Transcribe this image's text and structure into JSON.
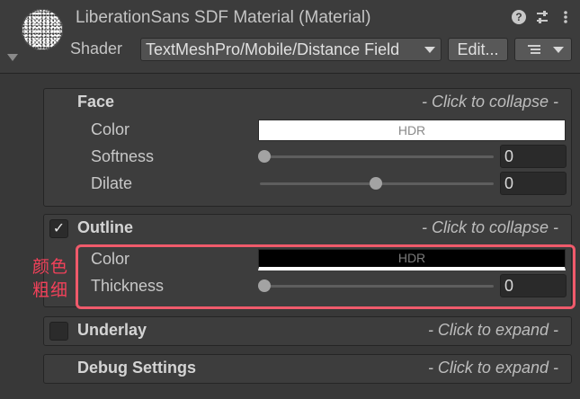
{
  "header": {
    "title": "LiberationSans SDF Material (Material)",
    "shader_label": "Shader",
    "shader_value": "TextMeshPro/Mobile/Distance Field",
    "edit_label": "Edit...",
    "icons": [
      "help-icon",
      "preset-settings-icon",
      "more-options-icon",
      "list-menu-icon"
    ]
  },
  "sections": {
    "face": {
      "title": "Face",
      "hint": "- Click to collapse -",
      "color_label": "Color",
      "color_value": "#ffffff",
      "color_badge": "HDR",
      "softness_label": "Softness",
      "softness_value": "0",
      "dilate_label": "Dilate",
      "dilate_value": "0"
    },
    "outline": {
      "title": "Outline",
      "enabled": true,
      "hint": "- Click to collapse -",
      "color_label": "Color",
      "color_value": "#000000",
      "color_badge": "HDR",
      "thickness_label": "Thickness",
      "thickness_value": "0"
    },
    "underlay": {
      "title": "Underlay",
      "enabled": false,
      "hint": "- Click to expand -"
    },
    "debug": {
      "title": "Debug Settings",
      "hint": "- Click to expand -"
    }
  },
  "annotation": {
    "line1": "颜色",
    "line2": "粗细",
    "color": "#f05a6b"
  }
}
